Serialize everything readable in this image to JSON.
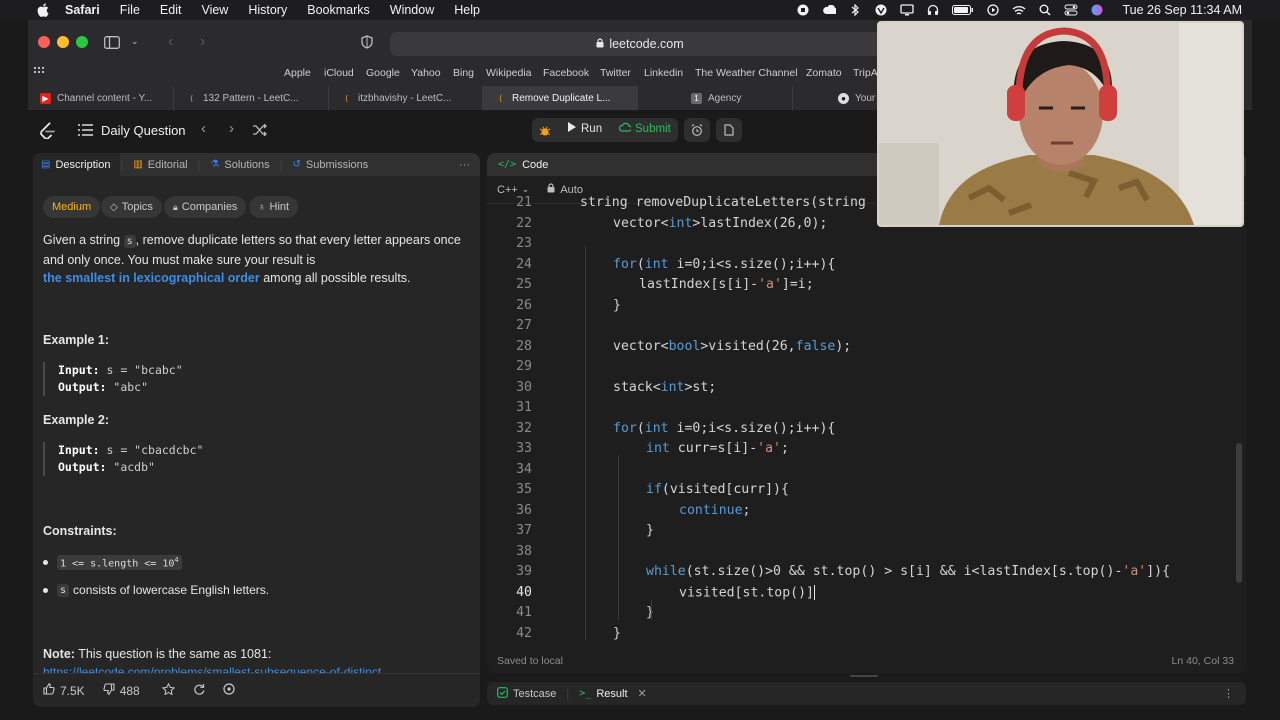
{
  "menubar": {
    "app": "Safari",
    "items": [
      "File",
      "Edit",
      "View",
      "History",
      "Bookmarks",
      "Window",
      "Help"
    ],
    "clock": "Tue 26 Sep  11:34 AM"
  },
  "browser": {
    "url": "leetcode.com",
    "favorites": [
      "Apple",
      "iCloud",
      "Google",
      "Yahoo",
      "Bing",
      "Wikipedia",
      "Facebook",
      "Twitter",
      "Linkedin",
      "The Weather Channel",
      "Zomato",
      "TripA"
    ],
    "tabs": [
      {
        "title": "Channel content - Y...",
        "active": false
      },
      {
        "title": "132 Pattern - LeetC...",
        "active": false
      },
      {
        "title": "itzbhavishy - LeetC...",
        "active": false
      },
      {
        "title": "Remove Duplicate L...",
        "active": true
      },
      {
        "title": "Agency",
        "active": false
      },
      {
        "title": "Your",
        "active": false
      }
    ]
  },
  "lc_header": {
    "title": "Daily Question",
    "run_label": "Run",
    "submit_label": "Submit"
  },
  "left_tabs": [
    "Description",
    "Editorial",
    "Solutions",
    "Submissions"
  ],
  "pills": {
    "difficulty": "Medium",
    "topics": "Topics",
    "companies": "Companies",
    "hint": "Hint"
  },
  "description": {
    "p1": "Given a string",
    "var_s": "s",
    "p2": ", remove duplicate letters so that every letter appears once and only once. You must make sure your result is",
    "link": "the smallest in lexicographical order",
    "p3": "among all possible results."
  },
  "examples": [
    {
      "title": "Example 1:",
      "input_label": "Input:",
      "input": "s = \"bcabc\"",
      "output_label": "Output:",
      "output": "\"abc\""
    },
    {
      "title": "Example 2:",
      "input_label": "Input:",
      "input": "s = \"cbacdcbc\"",
      "output_label": "Output:",
      "output": "\"acdb\""
    }
  ],
  "constraints": {
    "title": "Constraints:",
    "c1": "1 <= s.length <= 10",
    "c1_sup": "4",
    "c2_code": "s",
    "c2_text": "consists of lowercase English letters."
  },
  "note": {
    "label": "Note:",
    "text": "This question is the same as 1081:",
    "link": "https://leetcode.com/problems/smallest-subsequence-of-distinct"
  },
  "left_footer": {
    "likes": "7.5K",
    "dislikes": "488"
  },
  "code_panel": {
    "title": "Code",
    "language": "C++",
    "auto_label": "Auto",
    "status_left": "Saved to local",
    "status_right": "Ln 40, Col 33",
    "lines": [
      {
        "n": "21",
        "code": "string removeDuplicateLetters(string"
      },
      {
        "n": "22",
        "code": "vector<int>lastIndex(26,0);"
      },
      {
        "n": "23",
        "code": ""
      },
      {
        "n": "24",
        "code": "for(int i=0;i<s.size();i++){"
      },
      {
        "n": "25",
        "code": "lastIndex[s[i]-'a']=i;"
      },
      {
        "n": "26",
        "code": "}"
      },
      {
        "n": "27",
        "code": ""
      },
      {
        "n": "28",
        "code": "vector<bool>visited(26,false);"
      },
      {
        "n": "29",
        "code": ""
      },
      {
        "n": "30",
        "code": "stack<int>st;"
      },
      {
        "n": "31",
        "code": ""
      },
      {
        "n": "32",
        "code": "for(int i=0;i<s.size();i++){"
      },
      {
        "n": "33",
        "code": "int curr=s[i]-'a';"
      },
      {
        "n": "34",
        "code": ""
      },
      {
        "n": "35",
        "code": "if(visited[curr]){"
      },
      {
        "n": "36",
        "code": "continue;"
      },
      {
        "n": "37",
        "code": "}"
      },
      {
        "n": "38",
        "code": ""
      },
      {
        "n": "39",
        "code": "while(st.size()>0 && st.top() > s[i] && i<lastIndex[s.top()-'a']){"
      },
      {
        "n": "40",
        "code": "visited[st.top()]"
      },
      {
        "n": "41",
        "code": "}"
      },
      {
        "n": "42",
        "code": "}"
      }
    ]
  },
  "bottom_tabs": {
    "testcase": "Testcase",
    "result": "Result"
  }
}
